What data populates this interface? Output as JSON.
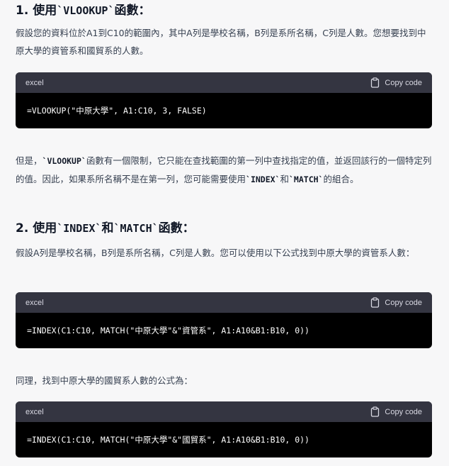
{
  "section1": {
    "heading_num": "1. ",
    "heading_pre": "使用",
    "heading_code": "`VLOOKUP`",
    "heading_post": "函數：",
    "para1": "假設您的資料位於A1到C10的範圍內，其中A列是學校名稱，B列是系所名稱，C列是人數。您想要找到中原大學的資管系和國貿系的人數。",
    "code1": {
      "lang": "excel",
      "copy_label": "Copy code",
      "code": "=VLOOKUP(\"中原大學\", A1:C10, 3, FALSE)"
    },
    "para2_a": "但是，",
    "para2_code1": "`VLOOKUP`",
    "para2_b": "函數有一個限制，它只能在查找範圍的第一列中查找指定的值，並返回該行的一個特定列的值。因此，如果系所名稱不是在第一列，您可能需要使用",
    "para2_code2": "`INDEX`",
    "para2_c": "和",
    "para2_code3": "`MATCH`",
    "para2_d": "的組合。"
  },
  "section2": {
    "heading_num": "2. ",
    "heading_pre": "使用",
    "heading_code1": "`INDEX`",
    "heading_mid": "和",
    "heading_code2": "`MATCH`",
    "heading_post": "函數：",
    "para1": "假設A列是學校名稱，B列是系所名稱，C列是人數。您可以使用以下公式找到中原大學的資管系人數：",
    "code2": {
      "lang": "excel",
      "copy_label": "Copy code",
      "code": "=INDEX(C1:C10, MATCH(\"中原大學\"&\"資管系\", A1:A10&B1:B10, 0))"
    },
    "para2": "同理，找到中原大學的國貿系人數的公式為：",
    "code3": {
      "lang": "excel",
      "copy_label": "Copy code",
      "code": "=INDEX(C1:C10, MATCH(\"中原大學\"&\"國貿系\", A1:A10&B1:B10, 0))"
    }
  },
  "icons": {
    "copy": "clipboard-icon"
  }
}
